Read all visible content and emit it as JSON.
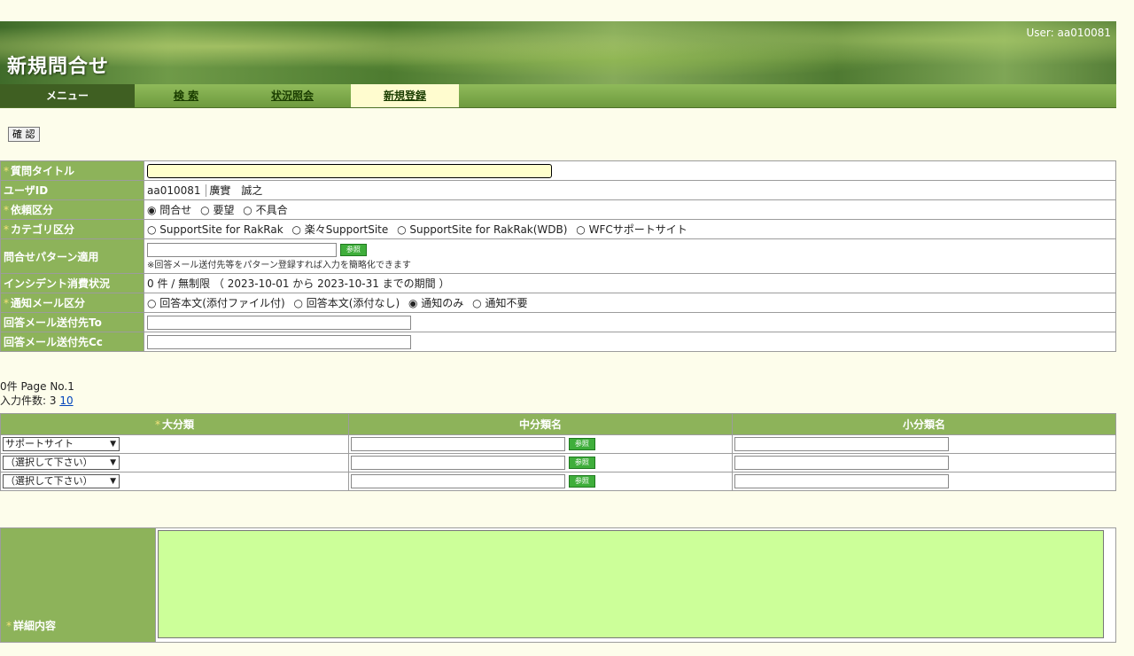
{
  "header": {
    "title": "新規問合せ",
    "user": "User:  aa010081"
  },
  "nav": {
    "menu": "メニュー",
    "search": "検 索",
    "status": "状況照会",
    "register": "新規登録"
  },
  "toolbar": {
    "confirm": "確 認"
  },
  "form": {
    "title_label": "質問タイトル",
    "userid_label": "ユーザID",
    "userid_value": "aa010081",
    "username_value": "廣實　誠之",
    "request_label": "依頼区分",
    "request_options": [
      "問合せ",
      "要望",
      "不具合"
    ],
    "category_label": "カテゴリ区分",
    "category_options": [
      "SupportSite for RakRak",
      "楽々SupportSite",
      "SupportSite for RakRak(WDB)",
      "WFCサポートサイト"
    ],
    "pattern_label": "問合せパターン適用",
    "pattern_note": "※回答メール送付先等をパターン登録すれば入力を簡略化できます",
    "ref_button": "参照",
    "incident_label": "インシデント消費状況",
    "incident_value": "0 件 / 無制限 （ 2023-10-01 から 2023-10-31 までの期間 ）",
    "notify_label": "通知メール区分",
    "notify_options": [
      "回答本文(添付ファイル付)",
      "回答本文(添付なし)",
      "通知のみ",
      "通知不要"
    ],
    "to_label": "回答メール送付先To",
    "cc_label": "回答メール送付先Cc",
    "required_mark": "*"
  },
  "count": {
    "line1": "0件 Page No.1",
    "line2_prefix": "入力件数: 3 ",
    "line2_link": "10"
  },
  "cat_table": {
    "headers": [
      "大分類",
      "中分類名",
      "小分類名"
    ],
    "rows": [
      {
        "major": "サポートサイト"
      },
      {
        "major": "（選択して下さい）"
      },
      {
        "major": "（選択して下さい）"
      }
    ]
  },
  "detail": {
    "label": "詳細内容"
  },
  "colors": {
    "label_bg": "#8db35a",
    "textarea_bg": "#ccff99",
    "page_bg": "#fdfdeb"
  }
}
